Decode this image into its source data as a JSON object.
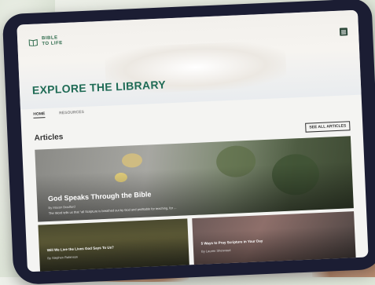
{
  "brand": {
    "name_line1": "BIBLE",
    "name_line2": "TO LIFE"
  },
  "hero": {
    "title": "EXPLORE THE LIBRARY"
  },
  "nav": {
    "items": [
      {
        "label": "HOME"
      },
      {
        "label": "RESOURCES"
      }
    ]
  },
  "articles": {
    "heading": "Articles",
    "see_all_label": "SEE ALL ARTICLES",
    "featured": {
      "title": "God Speaks Through the Bible",
      "meta": "By Mason Bradford",
      "description": "The Word tells us that \"all Scripture is breathed out by God and profitable for teaching, for ..."
    },
    "cards": [
      {
        "title": "Will We Live the Lives God Says To Us?",
        "author": "By Stephen Robinson"
      },
      {
        "title": "5 Ways to Pray Scripture in Your Day",
        "author": "By Lauren Sherwood"
      }
    ]
  },
  "colors": {
    "brand_green": "#1f6b55",
    "tablet_frame": "#1b1d33"
  }
}
